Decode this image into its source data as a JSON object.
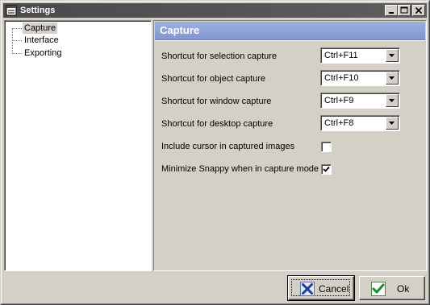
{
  "window": {
    "title": "Settings",
    "icon": "window-icon",
    "controls": {
      "minimize": "minimize-icon",
      "maximize": "maximize-icon",
      "close": "close-icon"
    }
  },
  "tree": {
    "items": [
      {
        "label": "Capture",
        "selected": true
      },
      {
        "label": "Interface",
        "selected": false
      },
      {
        "label": "Exporting",
        "selected": false
      }
    ]
  },
  "panel": {
    "header": "Capture",
    "header_color": "#8aa0d6",
    "shortcuts": [
      {
        "label": "Shortcut for selection capture",
        "value": "Ctrl+F11"
      },
      {
        "label": "Shortcut for object capture",
        "value": "Ctrl+F10"
      },
      {
        "label": "Shortcut for window capture",
        "value": "Ctrl+F9"
      },
      {
        "label": "Shortcut for desktop capture",
        "value": "Ctrl+F8"
      }
    ],
    "options": [
      {
        "label": "Include cursor in captured images",
        "checked": false
      },
      {
        "label": "Minimize Snappy when in capture mode",
        "checked": true
      }
    ]
  },
  "buttons": {
    "cancel": {
      "label": "Cancel",
      "icon": "x-icon",
      "icon_color": "#1f3fa0"
    },
    "ok": {
      "label": "Ok",
      "icon": "checkmark-icon",
      "icon_color": "#1a8a2a"
    }
  }
}
